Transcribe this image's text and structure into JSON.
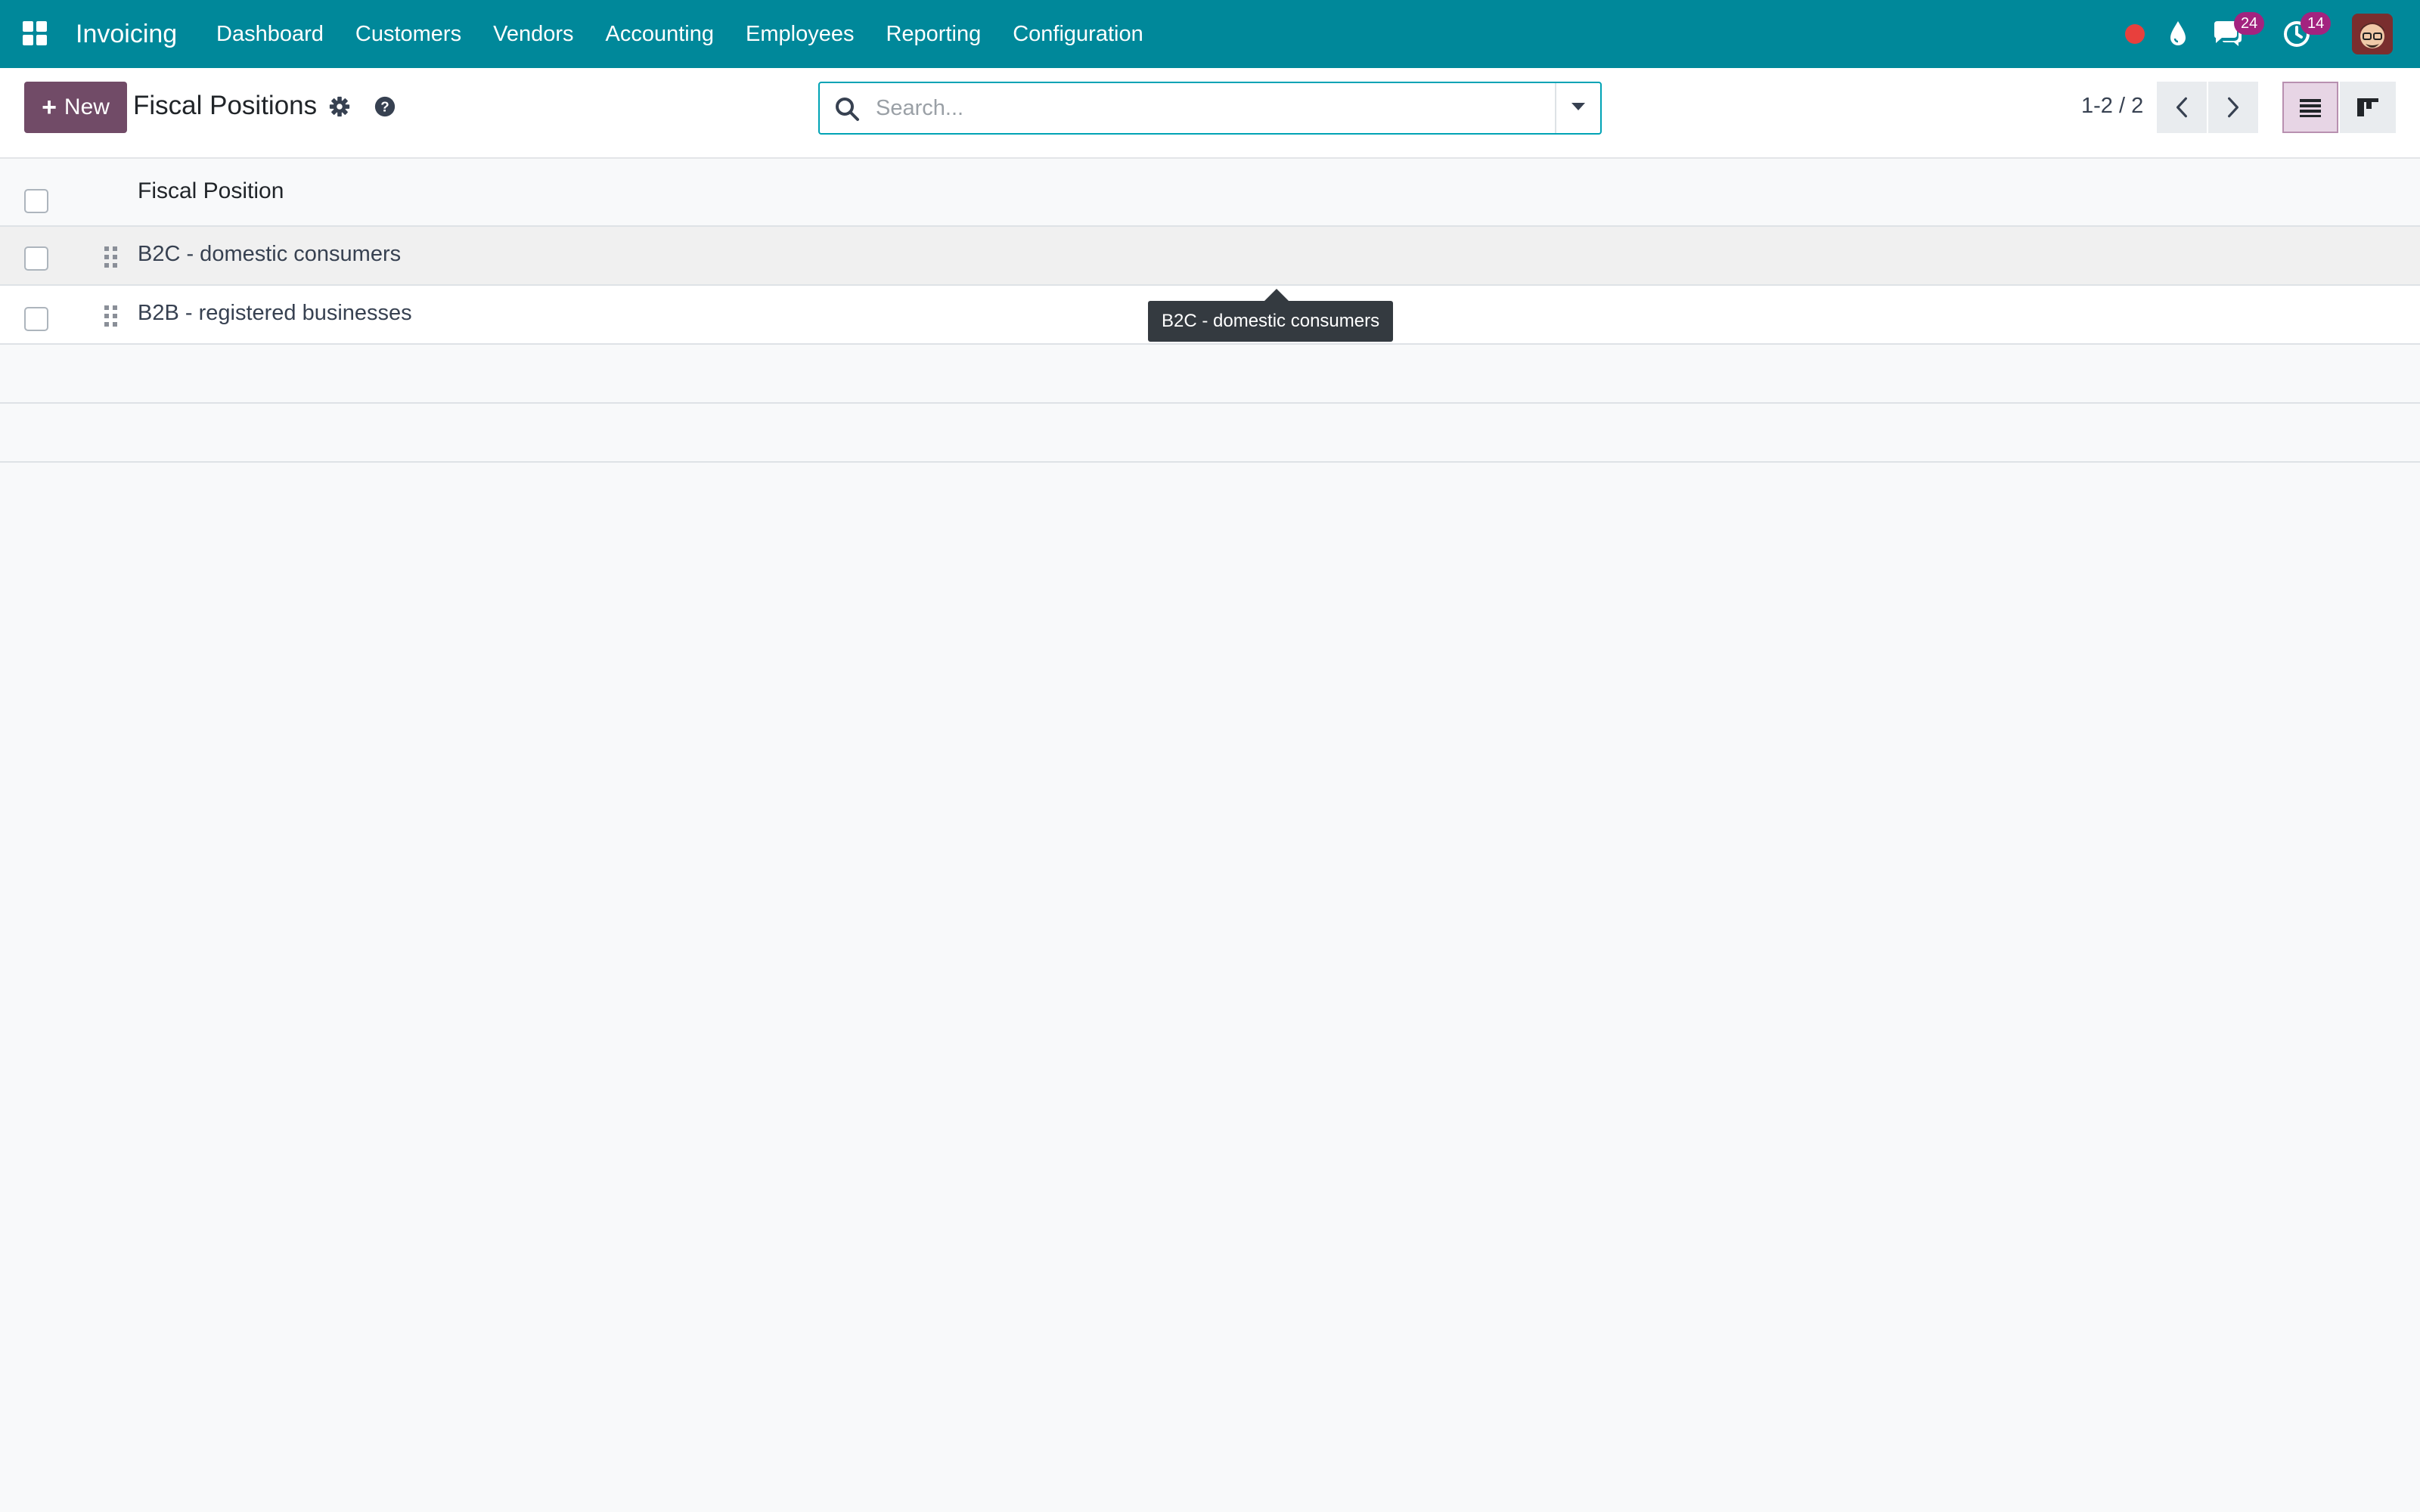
{
  "navbar": {
    "app_name": "Invoicing",
    "menu": [
      {
        "label": "Dashboard"
      },
      {
        "label": "Customers"
      },
      {
        "label": "Vendors"
      },
      {
        "label": "Accounting"
      },
      {
        "label": "Employees"
      },
      {
        "label": "Reporting"
      },
      {
        "label": "Configuration"
      }
    ],
    "systray": {
      "messages_count": "24",
      "activities_count": "14"
    },
    "colors": {
      "navbar_bg": "#00889a",
      "badge": "#a3237f",
      "recording": "#e8403d"
    }
  },
  "control_panel": {
    "new_label": "New",
    "title": "Fiscal Positions",
    "search_placeholder": "Search...",
    "pager": "1-2 / 2",
    "accent": "#714b67"
  },
  "list": {
    "column_header": "Fiscal Position",
    "rows": [
      {
        "label": "B2C - domestic consumers"
      },
      {
        "label": "B2B - registered businesses"
      }
    ]
  },
  "tooltip": {
    "text": "B2C - domestic consumers"
  },
  "icons": [
    "apps-grid-icon",
    "recording-icon",
    "drop-icon",
    "chat-icon",
    "clock-icon",
    "gear-icon",
    "help-icon",
    "search-icon",
    "caret-down-icon",
    "chevron-left-icon",
    "chevron-right-icon",
    "list-view-icon",
    "kanban-view-icon",
    "drag-handle-icon"
  ]
}
